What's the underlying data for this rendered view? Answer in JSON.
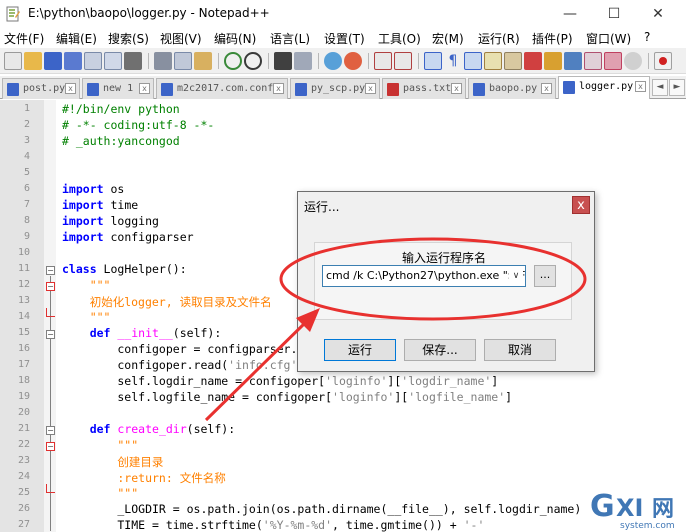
{
  "window": {
    "title": "E:\\python\\baopo\\logger.py - Notepad++",
    "minimize": "—",
    "maximize": "☐",
    "close": "✕"
  },
  "menu": [
    "文件(F)",
    "编辑(E)",
    "搜索(S)",
    "视图(V)",
    "编码(N)",
    "语言(L)",
    "设置(T)",
    "工具(O)",
    "宏(M)",
    "运行(R)",
    "插件(P)",
    "窗口(W)",
    "?"
  ],
  "tabs": [
    {
      "label": "post.py",
      "icon": "save-icon-blue"
    },
    {
      "label": "new 1",
      "icon": "save-icon-blue"
    },
    {
      "label": "m2c2017.com.conf",
      "icon": "save-icon-blue"
    },
    {
      "label": "py_scp.py",
      "icon": "save-icon-blue"
    },
    {
      "label": "pass.txt",
      "icon": "save-icon-red"
    },
    {
      "label": "baopo.py",
      "icon": "save-icon-blue"
    },
    {
      "label": "logger.py",
      "icon": "save-icon-blue",
      "active": true
    }
  ],
  "tab_scroll": {
    "left": "◄",
    "right": "►"
  },
  "editor": {
    "line_numbers": [
      "1",
      "2",
      "3",
      "4",
      "5",
      "6",
      "7",
      "8",
      "9",
      "10",
      "11",
      "12",
      "13",
      "14",
      "15",
      "16",
      "17",
      "18",
      "19",
      "20",
      "21",
      "22",
      "23",
      "24",
      "25",
      "26",
      "27"
    ],
    "lines": {
      "l1": "#!/bin/env python",
      "l2": "# -*- coding:utf-8 -*-",
      "l3": "# _auth:yancongod",
      "l6_kw": "import",
      "l6_rest": " os",
      "l7_kw": "import",
      "l7_rest": " time",
      "l8_kw": "import",
      "l8_rest": " logging",
      "l9_kw": "import",
      "l9_rest": " configparser",
      "l11_kw": "class",
      "l11_rest": " LogHelper():",
      "l12": "    \"\"\"",
      "l13": "    初始化logger, 读取目录及文件名",
      "l14": "    \"\"\"",
      "l15_kw": "def",
      "l15_fn": " __init__",
      "l15_rest": "(self):",
      "l16": "        configoper = configparser.",
      "l17a": "        configoper.read(",
      "l17s": "'info.cfg'",
      "l18a": "        self.logdir_name = configoper[",
      "l18s1": "'loginfo'",
      "l18m": "][",
      "l18s2": "'logdir_name'",
      "l18e": "]",
      "l19a": "        self.logfile_name = configoper[",
      "l19s1": "'loginfo'",
      "l19m": "][",
      "l19s2": "'logfile_name'",
      "l19e": "]",
      "l21_kw": "def",
      "l21_fn": " create_dir",
      "l21_rest": "(self):",
      "l22": "        \"\"\"",
      "l23": "        创建目录",
      "l24": "        :return: 文件名称",
      "l25": "        \"\"\"",
      "l26": "        _LOGDIR = os.path.join(os.path.dirname(__file__), self.logdir_name)",
      "l27a": "        TIME = time.strftime(",
      "l27s1": "'%Y-%m-%d'",
      "l27m": ", time.gmtime()) + ",
      "l27s2": "'-'"
    }
  },
  "run_dialog": {
    "title": "运行...",
    "close": "x",
    "group_label": "输入运行程序名",
    "command_value": "cmd /k C:\\Python27\\python.exe \"$(FU",
    "dropdown_arrow": "∨",
    "browse": "...",
    "run_button": "运行",
    "save_button": "保存...",
    "cancel_button": "取消"
  },
  "colors": {
    "annotation_red": "#e8312f",
    "keyword": "#0000ff",
    "comment": "#008000",
    "docstring": "#ff8000",
    "function": "#ff00ff"
  },
  "watermark": {
    "brand": "G X I 网",
    "url": "system.com"
  }
}
